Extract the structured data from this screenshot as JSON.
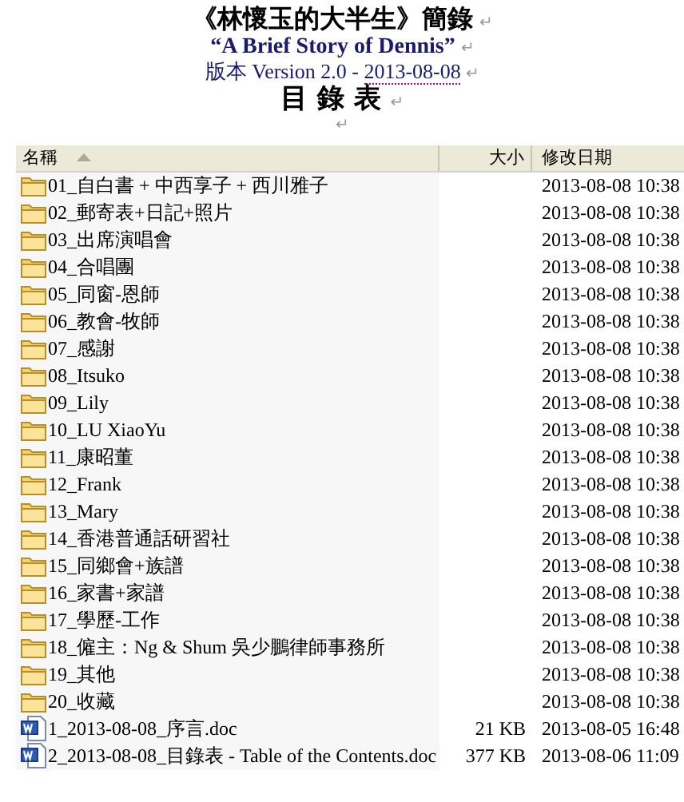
{
  "headings": [
    {
      "kind": "title",
      "text": "《林懷玉的大半生》簡錄",
      "mark": "↵"
    },
    {
      "kind": "subtitle",
      "text": "“A Brief Story of Dennis”",
      "mark": "↵"
    },
    {
      "kind": "version",
      "text": "版本 Version 2.0 - ",
      "date": "2013-08-08",
      "mark": "↵"
    },
    {
      "kind": "toc",
      "text": "目 錄 表",
      "mark": "↵"
    },
    {
      "kind": "blank",
      "mark": "↵"
    }
  ],
  "table": {
    "columns": [
      "名稱",
      "大小",
      "修改日期"
    ],
    "rows": [
      {
        "kind": "folder",
        "name": "01_自白書 + 中西享子 + 西川雅子",
        "date": "2013-08-08 10:38"
      },
      {
        "kind": "folder",
        "name": "02_郵寄表+日記+照片",
        "date": "2013-08-08 10:38"
      },
      {
        "kind": "folder",
        "name": "03_出席演唱會",
        "date": "2013-08-08 10:38"
      },
      {
        "kind": "folder",
        "name": "04_合唱團",
        "date": "2013-08-08 10:38"
      },
      {
        "kind": "folder",
        "name": "05_同窗-恩師",
        "date": "2013-08-08 10:38"
      },
      {
        "kind": "folder",
        "name": "06_教會-牧師",
        "date": "2013-08-08 10:38"
      },
      {
        "kind": "folder",
        "name": "07_感謝",
        "date": "2013-08-08 10:38"
      },
      {
        "kind": "folder",
        "name": "08_Itsuko",
        "date": "2013-08-08 10:38"
      },
      {
        "kind": "folder",
        "name": "09_Lily",
        "date": "2013-08-08 10:38"
      },
      {
        "kind": "folder",
        "name": "10_LU XiaoYu",
        "date": "2013-08-08 10:38"
      },
      {
        "kind": "folder",
        "name": "11_康昭董",
        "date": "2013-08-08 10:38"
      },
      {
        "kind": "folder",
        "name": "12_Frank",
        "date": "2013-08-08 10:38"
      },
      {
        "kind": "folder",
        "name": "13_Mary",
        "date": "2013-08-08 10:38"
      },
      {
        "kind": "folder",
        "name": "14_香港普通話研習社",
        "date": "2013-08-08 10:38"
      },
      {
        "kind": "folder",
        "name": "15_同鄉會+族譜",
        "date": "2013-08-08 10:38"
      },
      {
        "kind": "folder",
        "name": "16_家書+家譜",
        "date": "2013-08-08 10:38"
      },
      {
        "kind": "folder",
        "name": "17_學歷-工作",
        "date": "2013-08-08 10:38"
      },
      {
        "kind": "folder",
        "name": "18_僱主：Ng & Shum 吳少鵬律師事務所",
        "date": "2013-08-08 10:38"
      },
      {
        "kind": "folder",
        "name": "19_其他",
        "date": "2013-08-08 10:38"
      },
      {
        "kind": "folder",
        "name": "20_收藏",
        "date": "2013-08-08 10:38"
      },
      {
        "kind": "doc",
        "name": "1_2013-08-08_序言.doc",
        "size": "21 KB",
        "date": "2013-08-05 16:48"
      },
      {
        "kind": "doc",
        "name": "2_2013-08-08_目錄表 - Table of the Contents.doc",
        "size": "377 KB",
        "date": "2013-08-06 11:09"
      }
    ]
  }
}
